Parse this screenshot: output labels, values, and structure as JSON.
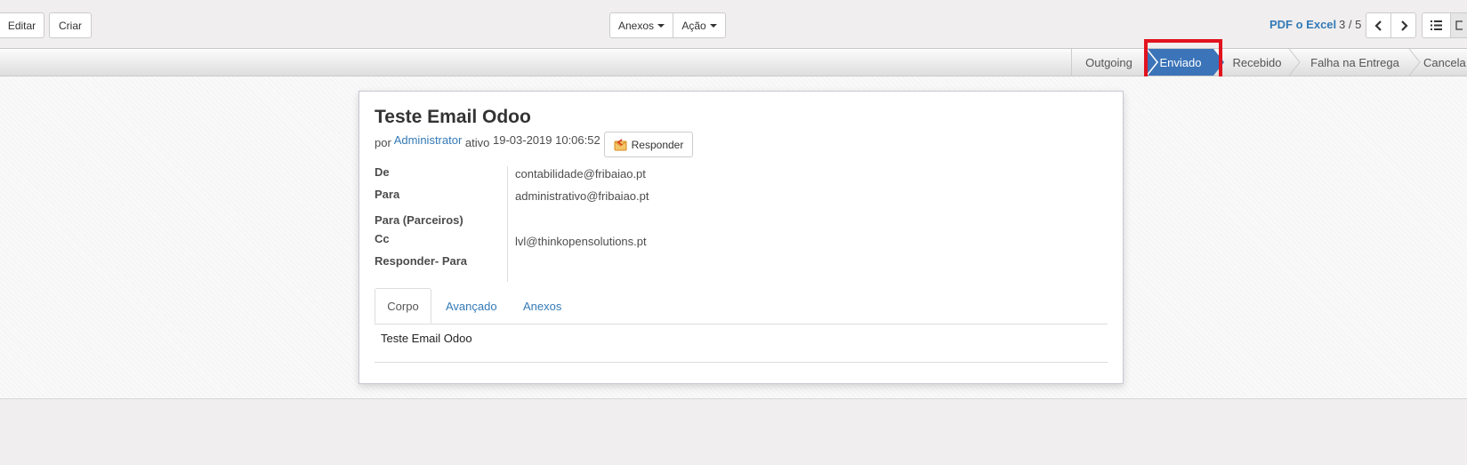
{
  "toolbar": {
    "edit_label": "Editar",
    "create_label": "Criar",
    "attachments_label": "Anexos",
    "action_label": "Ação"
  },
  "pager": {
    "export_link": "PDF o Excel",
    "position": "3 / 5"
  },
  "statusbar": {
    "stages": [
      "Outgoing",
      "Enviado",
      "Recebido",
      "Falha na Entrega",
      "Cancela"
    ],
    "active_stage": "Enviado"
  },
  "message": {
    "subject": "Teste Email Odoo",
    "by_label": "por",
    "author": "Administrator",
    "active_label": "ativo",
    "date": "19-03-2019 10:06:52",
    "reply_label": "Responder"
  },
  "fields": {
    "from_label": "De",
    "from_value": "contabilidade@fribaiao.pt",
    "to_label": "Para",
    "to_value": "administrativo@fribaiao.pt",
    "to_partners_label": "Para (Parceiros)",
    "cc_label": "Cc",
    "cc_value": "lvl@thinkopensolutions.pt",
    "reply_to_label": "Responder- Para"
  },
  "tabs": [
    "Corpo",
    "Avançado",
    "Anexos"
  ],
  "body": {
    "text": "Teste Email Odoo"
  },
  "colors": {
    "accent": "#3b74b8",
    "highlight": "#e1131e",
    "link": "#337ab7"
  }
}
